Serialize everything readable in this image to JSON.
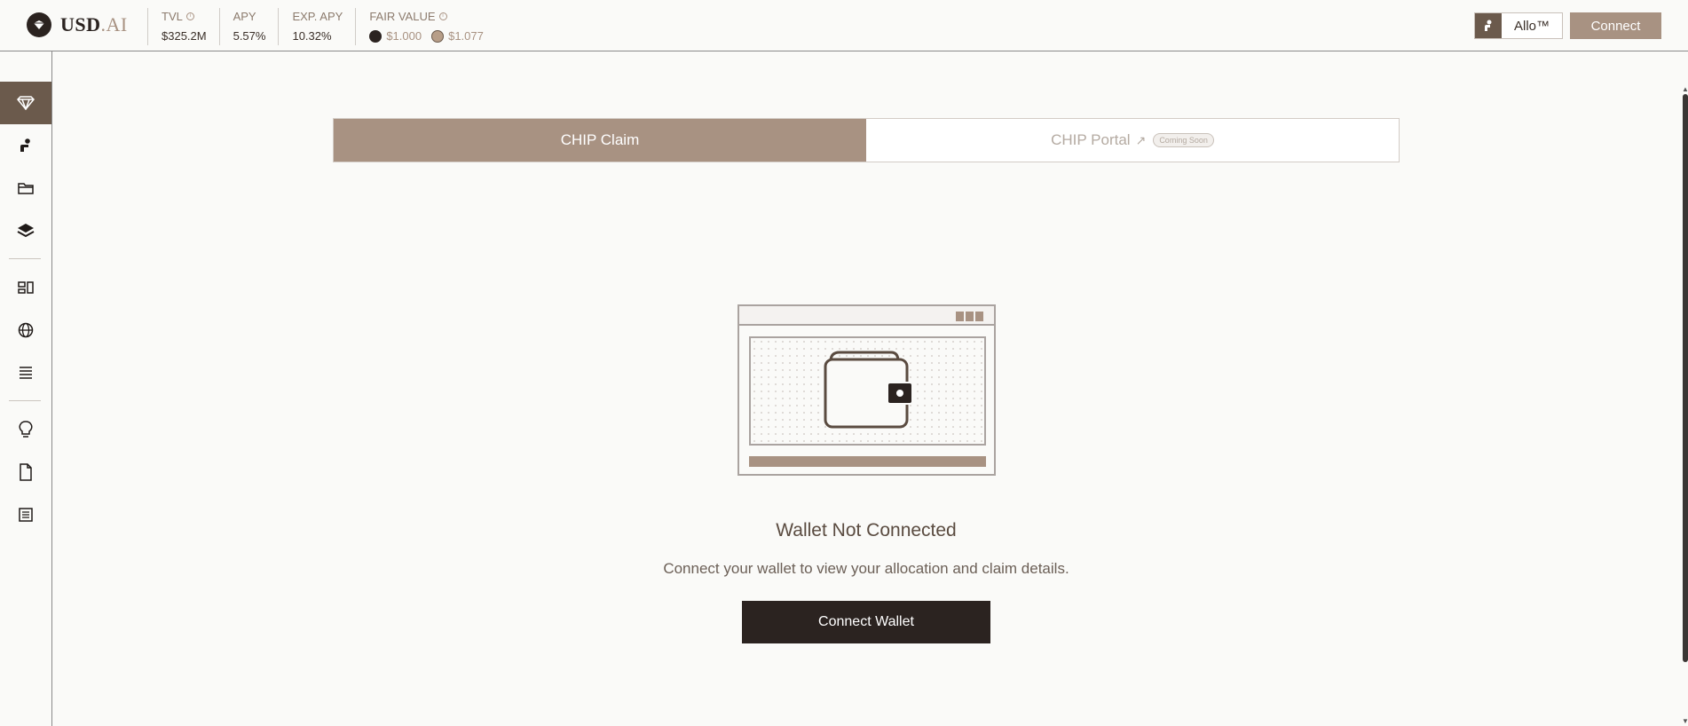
{
  "brand": {
    "usd": "USD",
    "ai": ".AI"
  },
  "stats": [
    {
      "label": "TVL",
      "value": "$325.2M",
      "info": true
    },
    {
      "label": "APY",
      "value": "5.57%",
      "info": false
    },
    {
      "label": "EXP. APY",
      "value": "10.32%",
      "info": false
    }
  ],
  "fair_value": {
    "label": "FAIR VALUE",
    "value_a": "$1.000",
    "value_b": "$1.077"
  },
  "header": {
    "allo_label": "Allo™",
    "connect_label": "Connect"
  },
  "sidebar": {
    "items": [
      {
        "icon": "diamond-icon",
        "active": true
      },
      {
        "icon": "seated-person-icon"
      },
      {
        "icon": "folder-icon"
      },
      {
        "icon": "layers-icon"
      },
      {
        "icon": "dashboard-icon"
      },
      {
        "icon": "globe-icon"
      },
      {
        "icon": "list-icon"
      },
      {
        "icon": "lightbulb-icon"
      },
      {
        "icon": "document-icon"
      },
      {
        "icon": "newspaper-icon"
      }
    ]
  },
  "tabs": [
    {
      "label": "CHIP Claim",
      "active": true
    },
    {
      "label": "CHIP Portal",
      "arrow": "↗",
      "badge": "Coming Soon",
      "active": false
    }
  ],
  "empty_state": {
    "title": "Wallet Not Connected",
    "subtitle": "Connect your wallet to view your allocation and claim details.",
    "button": "Connect Wallet"
  },
  "colors": {
    "accent": "#a89282",
    "dark": "#2b2320",
    "active_nav": "#6b5a4c"
  }
}
